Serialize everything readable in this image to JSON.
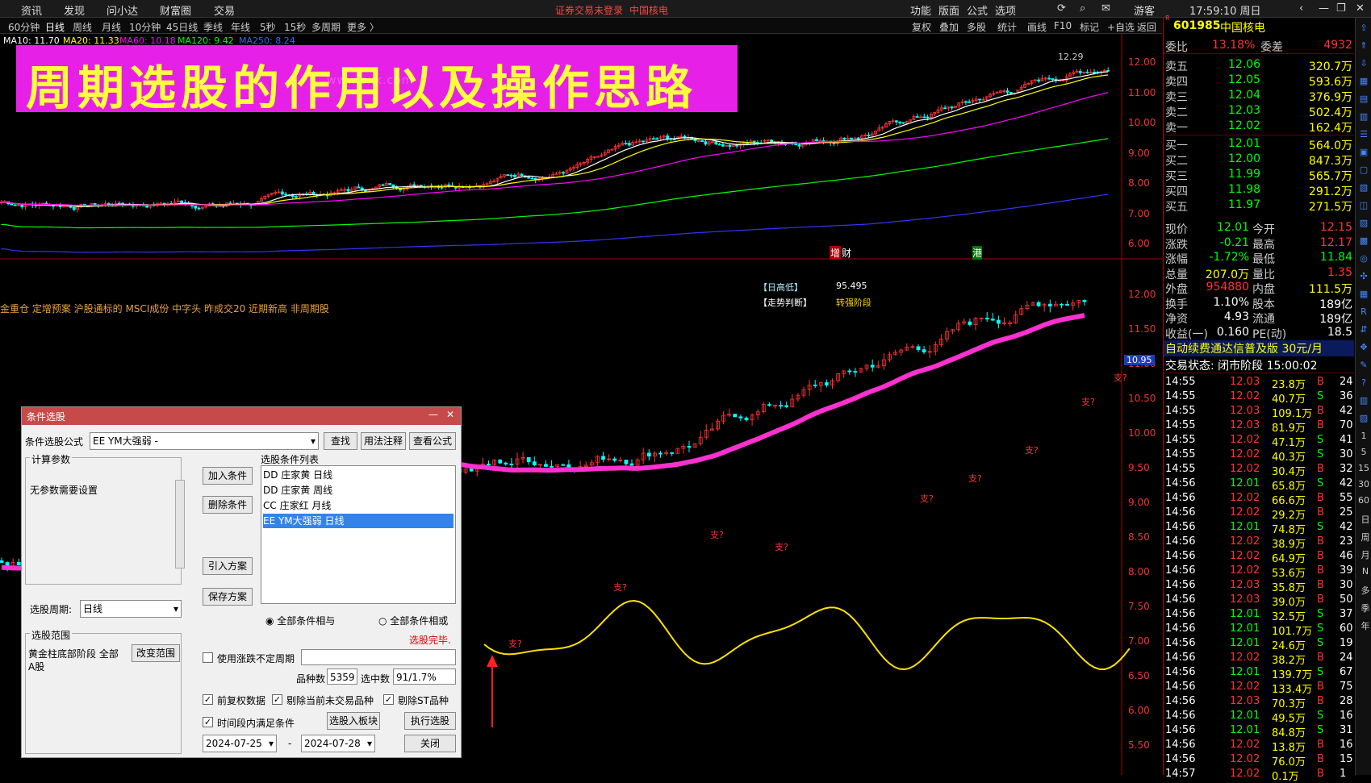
{
  "topmenu": {
    "items": [
      "资讯",
      "发现",
      "问小达",
      "财富圈",
      "交易"
    ],
    "status": "证券交易未登录",
    "stock_name_center": "中国核电",
    "right_items": [
      "功能",
      "版面",
      "公式",
      "选项"
    ],
    "user": "游客",
    "clock": "17:59:10 周日"
  },
  "toolbar": {
    "periods": [
      "60分钟",
      "日线",
      "周线",
      "月线",
      "10分钟",
      "45日线",
      "季线",
      "年线",
      "5秒",
      "15秒",
      "多周期",
      "更多 〉"
    ],
    "right": [
      "复权",
      "叠加",
      "多股",
      "统计",
      "画线",
      "F10",
      "标记",
      "+自选",
      "返回"
    ]
  },
  "ma_labels": [
    {
      "text": "MA10: 11.70",
      "color": "#ffffff"
    },
    {
      "text": "MA20: 11.33",
      "color": "#ffff00"
    },
    {
      "text": "MA60: 10.18",
      "color": "#ff00ff"
    },
    {
      "text": "MA120: 9.42",
      "color": "#00ff00"
    },
    {
      "text": "MA250: 8.24",
      "color": "#3060ff"
    }
  ],
  "banner": {
    "text": "周期选股的作用以及操作思路",
    "watermark": "www.oxk.com"
  },
  "chart1": {
    "y_ticks": [
      "12.00",
      "11.00",
      "10.00",
      "9.00",
      "8.00",
      "7.00",
      "6.00"
    ],
    "high_label": "12.29",
    "markers": [
      "增",
      "财",
      "港"
    ]
  },
  "chart2": {
    "y_ticks": [
      "12.00",
      "11.50",
      "11.00",
      "10.50",
      "10.00",
      "9.50",
      "9.00",
      "8.50",
      "8.00",
      "7.50",
      "7.00",
      "6.50",
      "6.00",
      "5.50"
    ],
    "price_tag": "10.95",
    "tags_line": "金重仓 定增预案 沪股通标的 MSCI成份 中字头 昨成交20 近期新高 非周期股",
    "info": [
      {
        "k": "【日高低】",
        "v": "95.495"
      },
      {
        "k": "【走势判断】",
        "v": "转强阶段"
      }
    ],
    "signal_label": "支?"
  },
  "chart_data": {
    "type": "line",
    "note": "",
    "series": [
      {
        "name": "price",
        "values": [
          6.9,
          6.95,
          7.0,
          7.1,
          6.9,
          7.2,
          7.4,
          7.6,
          7.9,
          8.3,
          8.5,
          8.4,
          8.9,
          9.2,
          9.1,
          9.0,
          9.3,
          9.7,
          10.1,
          10.6,
          11.0,
          11.5,
          12.0,
          12.29
        ]
      }
    ]
  },
  "rightpanel": {
    "code": "601985",
    "name": "中国核电",
    "wb": {
      "label": "委比",
      "value": "13.18%",
      "label2": "委差",
      "value2": "4932"
    },
    "sell": [
      {
        "l": "卖五",
        "v": "12.06",
        "q": "320.7万"
      },
      {
        "l": "卖四",
        "v": "12.05",
        "q": "593.6万"
      },
      {
        "l": "卖三",
        "v": "12.04",
        "q": "376.9万"
      },
      {
        "l": "卖二",
        "v": "12.03",
        "q": "502.4万"
      },
      {
        "l": "卖一",
        "v": "12.02",
        "q": "162.4万"
      }
    ],
    "buy": [
      {
        "l": "买一",
        "v": "12.01",
        "q": "564.0万"
      },
      {
        "l": "买二",
        "v": "12.00",
        "q": "847.3万"
      },
      {
        "l": "买三",
        "v": "11.99",
        "q": "565.7万"
      },
      {
        "l": "买四",
        "v": "11.98",
        "q": "291.2万"
      },
      {
        "l": "买五",
        "v": "11.97",
        "q": "271.5万"
      }
    ],
    "stats": [
      {
        "a": "现价",
        "b": "12.01",
        "c": "今开",
        "d": "12.15"
      },
      {
        "a": "涨跌",
        "b": "-0.21",
        "c": "最高",
        "d": "12.17"
      },
      {
        "a": "涨幅",
        "b": "-1.72%",
        "c": "最低",
        "d": "11.84"
      },
      {
        "a": "总量",
        "b": "207.0万",
        "c": "量比",
        "d": "1.35"
      },
      {
        "a": "外盘",
        "b": "954880",
        "c": "内盘",
        "d": "111.5万"
      },
      {
        "a": "换手",
        "b": "1.10%",
        "c": "股本",
        "d": "189亿"
      },
      {
        "a": "净资",
        "b": "4.93",
        "c": "流通",
        "d": "189亿"
      },
      {
        "a": "收益(一)",
        "b": "0.160",
        "c": "PE(动)",
        "d": "18.5"
      }
    ],
    "promo": "自动续费通达信普及版  30元/月",
    "trade_status": "交易状态: 闭市阶段 15:00:02",
    "ticks": [
      [
        "14:55",
        "12.03",
        "23.8万",
        "B",
        "24"
      ],
      [
        "14:55",
        "12.02",
        "40.7万",
        "S",
        "36"
      ],
      [
        "14:55",
        "12.03",
        "109.1万",
        "B",
        "42"
      ],
      [
        "14:55",
        "12.03",
        "81.9万",
        "B",
        "70"
      ],
      [
        "14:55",
        "12.02",
        "47.1万",
        "S",
        "41"
      ],
      [
        "14:55",
        "12.02",
        "40.3万",
        "S",
        "30"
      ],
      [
        "14:55",
        "12.02",
        "30.4万",
        "B",
        "32"
      ],
      [
        "14:56",
        "12.01",
        "65.8万",
        "S",
        "42"
      ],
      [
        "14:56",
        "12.02",
        "66.6万",
        "B",
        "55"
      ],
      [
        "14:56",
        "12.02",
        "29.2万",
        "B",
        "25"
      ],
      [
        "14:56",
        "12.01",
        "74.8万",
        "S",
        "42"
      ],
      [
        "14:56",
        "12.02",
        "38.9万",
        "B",
        "23"
      ],
      [
        "14:56",
        "12.02",
        "64.9万",
        "B",
        "46"
      ],
      [
        "14:56",
        "12.02",
        "53.6万",
        "B",
        "39"
      ],
      [
        "14:56",
        "12.03",
        "35.8万",
        "B",
        "30"
      ],
      [
        "14:56",
        "12.03",
        "39.0万",
        "B",
        "50"
      ],
      [
        "14:56",
        "12.01",
        "32.5万",
        "S",
        "37"
      ],
      [
        "14:56",
        "12.01",
        "101.7万",
        "S",
        "60"
      ],
      [
        "14:56",
        "12.01",
        "24.6万",
        "S",
        "19"
      ],
      [
        "14:56",
        "12.02",
        "38.2万",
        "B",
        "24"
      ],
      [
        "14:56",
        "12.01",
        "139.7万",
        "S",
        "67"
      ],
      [
        "14:56",
        "12.02",
        "133.4万",
        "B",
        "75"
      ],
      [
        "14:56",
        "12.03",
        "70.3万",
        "B",
        "28"
      ],
      [
        "14:56",
        "12.01",
        "49.5万",
        "S",
        "16"
      ],
      [
        "14:56",
        "12.01",
        "84.8万",
        "S",
        "31"
      ],
      [
        "14:56",
        "12.02",
        "13.8万",
        "B",
        "16"
      ],
      [
        "14:56",
        "12.02",
        "76.0万",
        "B",
        "15"
      ],
      [
        "14:57",
        "12.02",
        "0.1万",
        "B",
        "1"
      ]
    ]
  },
  "sidebar_icons": [
    "日",
    "周",
    "月",
    "N",
    "多",
    "季",
    "年"
  ],
  "dialog": {
    "title": "条件选股",
    "formula_label": "条件选股公式",
    "formula_value": "EE YM大强弱  -",
    "btn_find": "查找",
    "btn_usage": "用法注释",
    "btn_view": "查看公式",
    "calc_group": "计算参数",
    "no_param": "无参数需要设置",
    "btn_add": "加入条件",
    "btn_del": "删除条件",
    "list_title": "选股条件列表",
    "conditions": [
      "DD 庄家黄  日线",
      "DD 庄家黄  周线",
      "CC 庄家红  月线",
      "EE YM大强弱  日线"
    ],
    "btn_import": "引入方案",
    "btn_save": "保存方案",
    "period_label": "选股周期:",
    "period_value": "日线",
    "radio_and": "全部条件相与",
    "radio_or": "全部条件相或",
    "done": "选股完毕.",
    "range_group": "选股范围",
    "range_value": "黄金柱底部阶段 全部A股",
    "btn_range": "改变范围",
    "use_limit": "使用涨跌不定周期",
    "count_label": "品种数",
    "count_value": "5359",
    "sel_label": "选中数",
    "sel_value": "91/1.7%",
    "cb_fq": "前复权数据",
    "cb_cur": "剔除当前未交易品种",
    "cb_st": "剔除ST品种",
    "cb_time": "时间段内满足条件",
    "btn_block": "选股入板块",
    "btn_exec": "执行选股",
    "date_from": "2024-07-25",
    "date_to": "2024-07-28",
    "dash": "-",
    "btn_close": "关闭"
  }
}
